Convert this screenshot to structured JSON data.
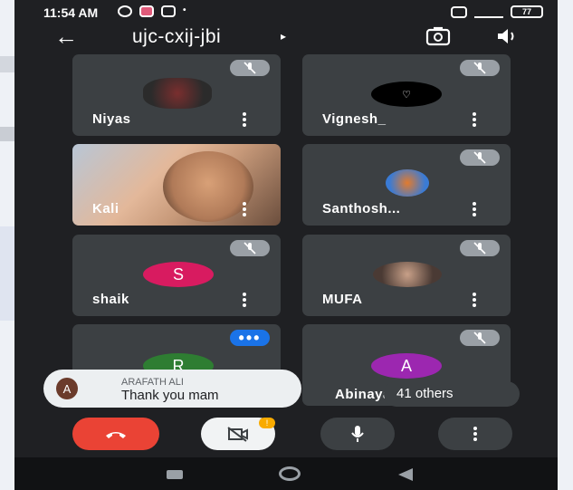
{
  "status_bar": {
    "time": "11:54 AM",
    "battery": "77"
  },
  "header": {
    "meeting_code": "ujc-cxij-jbi",
    "caret": "▸"
  },
  "participants": [
    {
      "name": "Niyas",
      "avatar": "photo",
      "muted": true
    },
    {
      "name": "Vignesh_",
      "avatar": "photo",
      "muted": true
    },
    {
      "name": "Kali",
      "avatar": "video",
      "muted": false
    },
    {
      "name": "Santhosh...",
      "avatar": "photo",
      "muted": true
    },
    {
      "name": "shaik",
      "avatar_letter": "S",
      "muted": true
    },
    {
      "name": "MUFA",
      "avatar": "photo",
      "muted": true
    },
    {
      "name": "",
      "avatar_letter": "R",
      "muted": false,
      "speaking": true
    },
    {
      "name": "Abinaya",
      "avatar_letter": "A",
      "muted": true
    }
  ],
  "others_count_label": "41 others",
  "chat_toast": {
    "avatar_letter": "A",
    "sender": "ARAFATH ALI",
    "message": "Thank you mam"
  },
  "controls": [
    {
      "label": "end-call",
      "icon": "hangup-icon"
    },
    {
      "label": "camera-off",
      "icon": "camera-off-icon",
      "badge": "!"
    },
    {
      "label": "microphone",
      "icon": "mic-icon"
    },
    {
      "label": "more",
      "icon": "more-icon"
    }
  ],
  "colors": {
    "end_call": "#ea4335",
    "tile": "#3c4043",
    "background": "#1f2023",
    "shaik_avatar": "#d81b60",
    "r_avatar": "#2e7d32",
    "a_avatar": "#9c27b0"
  }
}
